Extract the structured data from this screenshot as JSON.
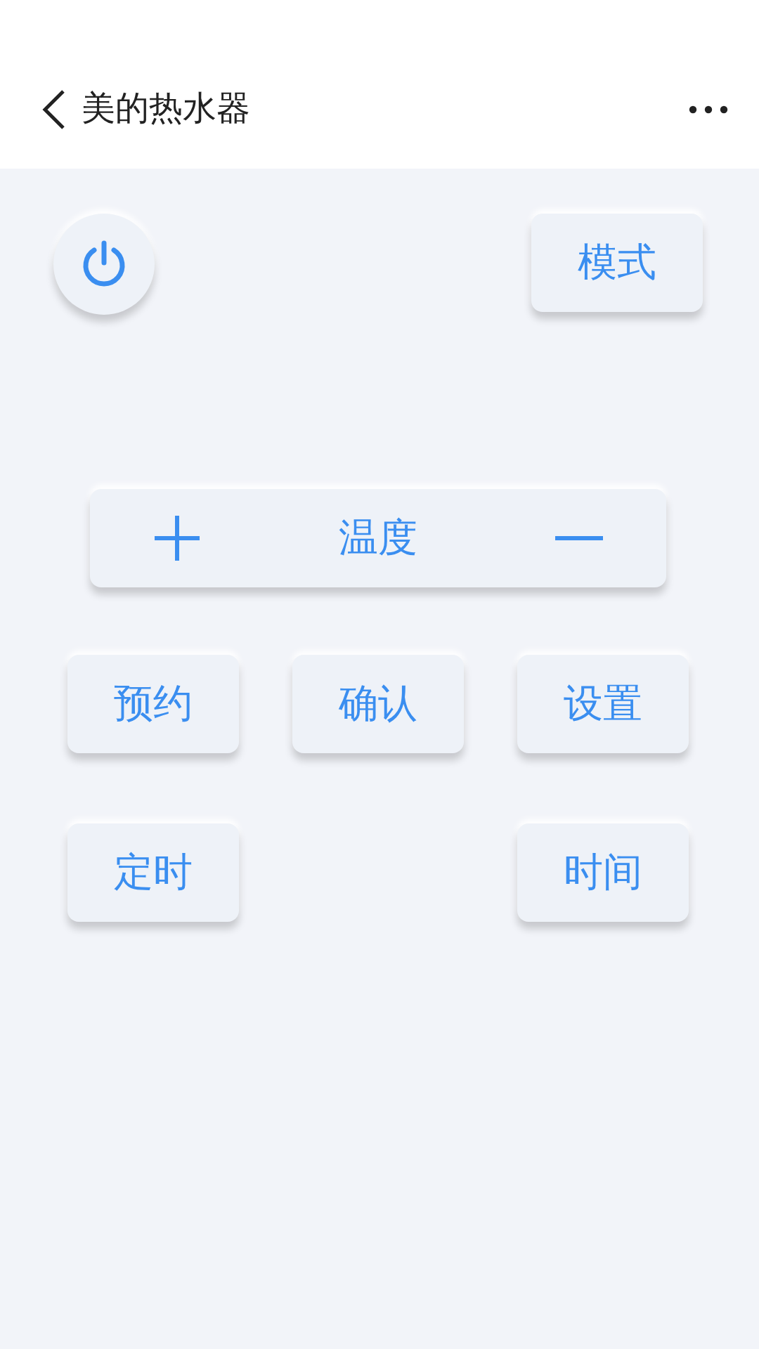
{
  "header": {
    "title": "美的热水器"
  },
  "mode_button": {
    "label": "模式"
  },
  "temperature": {
    "label": "温度"
  },
  "keypad_rows": [
    [
      "预约",
      "确认",
      "设置"
    ],
    [
      "定时",
      "时间"
    ]
  ]
}
